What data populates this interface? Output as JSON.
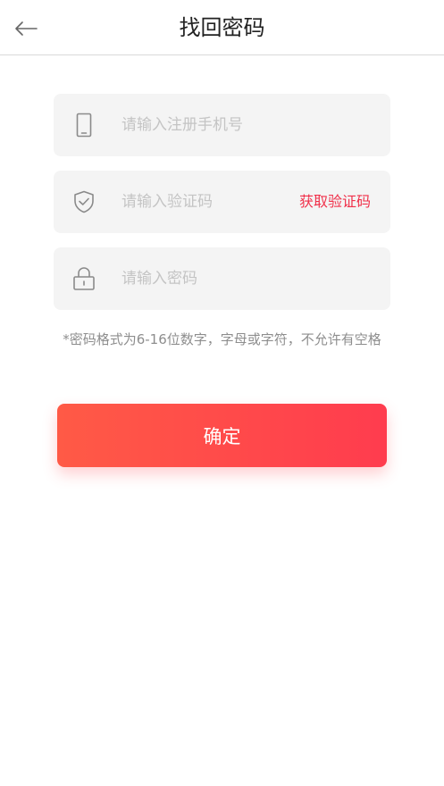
{
  "header": {
    "title": "找回密码",
    "back_icon": "arrow-left-icon"
  },
  "form": {
    "phone": {
      "placeholder": "请输入注册手机号",
      "value": "",
      "icon": "phone-icon"
    },
    "code": {
      "placeholder": "请输入验证码",
      "value": "",
      "icon": "shield-check-icon",
      "send_label": "获取验证码"
    },
    "password": {
      "placeholder": "请输入密码",
      "value": "",
      "icon": "lock-icon"
    },
    "hint": "*密码格式为6-16位数字，字母或字符，不允许有空格",
    "submit_label": "确定"
  },
  "colors": {
    "accent": "#f0304a",
    "button_gradient_start": "#ff5a46",
    "button_gradient_end": "#ff3c4e",
    "field_bg": "#f4f4f4"
  }
}
